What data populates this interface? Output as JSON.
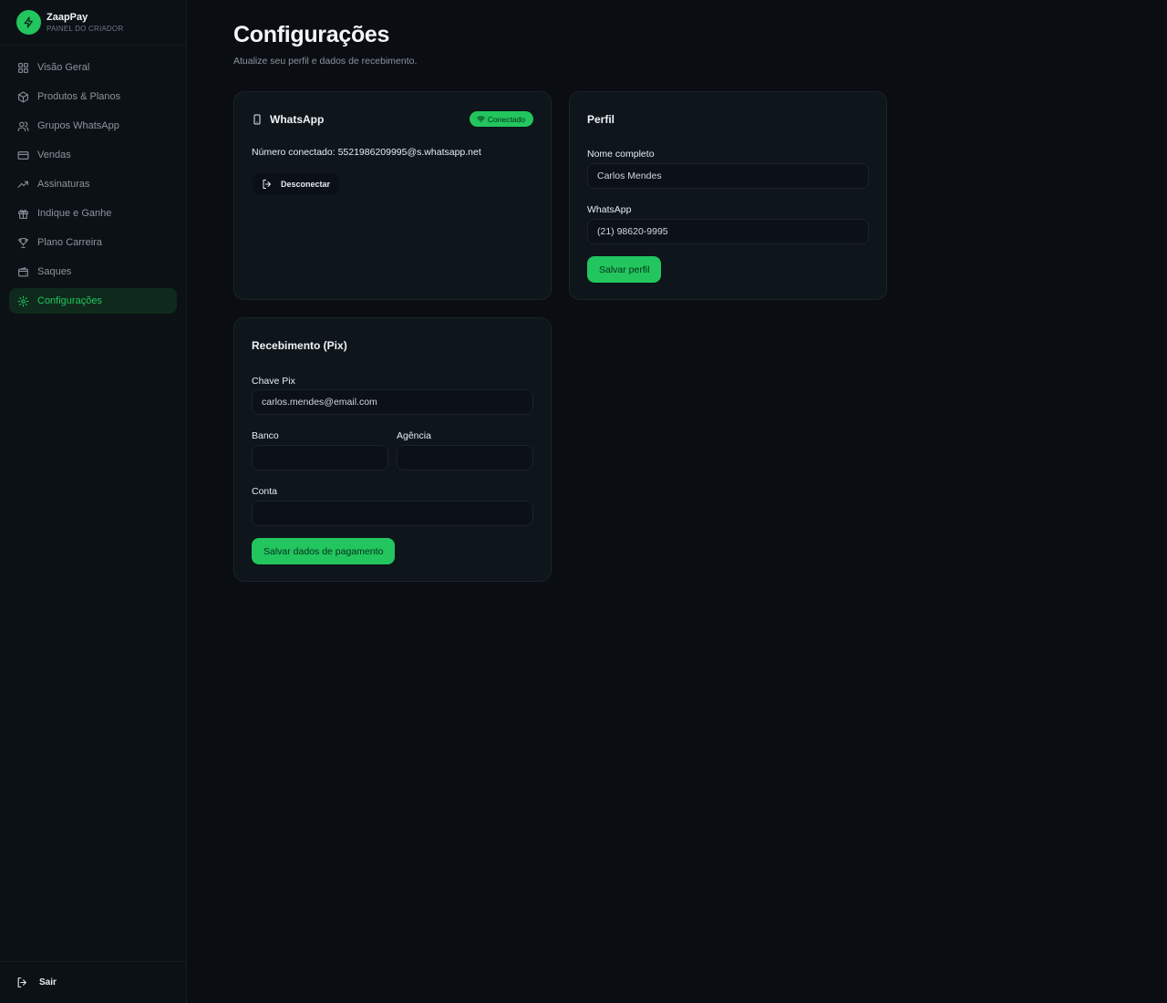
{
  "brand": {
    "name": "ZaapPay",
    "subtitle": "PAINEL DO CRIADOR",
    "accent": "#22c55e"
  },
  "sidebar": {
    "items": [
      {
        "label": "Visão Geral",
        "icon": "grid-icon",
        "active": false
      },
      {
        "label": "Produtos & Planos",
        "icon": "package-icon",
        "active": false
      },
      {
        "label": "Grupos WhatsApp",
        "icon": "users-icon",
        "active": false
      },
      {
        "label": "Vendas",
        "icon": "credit-card-icon",
        "active": false
      },
      {
        "label": "Assinaturas",
        "icon": "trending-up-icon",
        "active": false
      },
      {
        "label": "Indique e Ganhe",
        "icon": "gift-icon",
        "active": false
      },
      {
        "label": "Plano Carreira",
        "icon": "trophy-icon",
        "active": false
      },
      {
        "label": "Saques",
        "icon": "wallet-icon",
        "active": false
      },
      {
        "label": "Configurações",
        "icon": "gear-icon",
        "active": true
      }
    ],
    "logout_label": "Sair"
  },
  "page": {
    "title": "Configurações",
    "subtitle": "Atualize seu perfil e dados de recebimento."
  },
  "whatsapp_card": {
    "title": "WhatsApp",
    "status_badge": "Conectado",
    "connected_label": "Número conectado:",
    "connected_number": "5521986209995@s.whatsapp.net",
    "disconnect_label": "Desconectar"
  },
  "profile_card": {
    "title": "Perfil",
    "name_label": "Nome completo",
    "name_value": "Carlos Mendes",
    "whatsapp_label": "WhatsApp",
    "whatsapp_value": "(21) 98620-9995",
    "save_label": "Salvar perfil"
  },
  "payment_card": {
    "title": "Recebimento (Pix)",
    "pix_label": "Chave Pix",
    "pix_value": "carlos.mendes@email.com",
    "bank_label": "Banco",
    "bank_value": "",
    "agency_label": "Agência",
    "agency_value": "",
    "account_label": "Conta",
    "account_value": "",
    "save_label": "Salvar dados de pagamento"
  }
}
